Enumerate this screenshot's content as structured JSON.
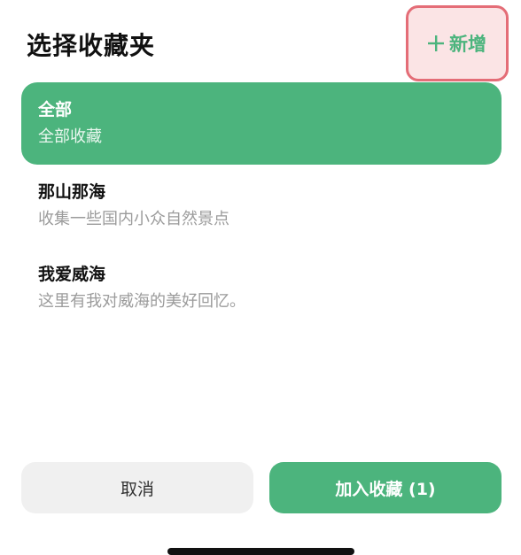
{
  "header": {
    "title": "选择收藏夹",
    "add_label": "新增"
  },
  "folders": [
    {
      "name": "全部",
      "description": "全部收藏",
      "selected": true
    },
    {
      "name": "那山那海",
      "description": "收集一些国内小众自然景点",
      "selected": false
    },
    {
      "name": "我爱威海",
      "description": "这里有我对威海的美好回忆。",
      "selected": false
    }
  ],
  "footer": {
    "cancel_label": "取消",
    "confirm_label": "加入收藏 (1)"
  },
  "colors": {
    "accent": "#4cb47d",
    "highlight_border": "#e46d77",
    "highlight_fill": "#fbe4e5"
  },
  "icons": {
    "add": "plus-icon"
  }
}
